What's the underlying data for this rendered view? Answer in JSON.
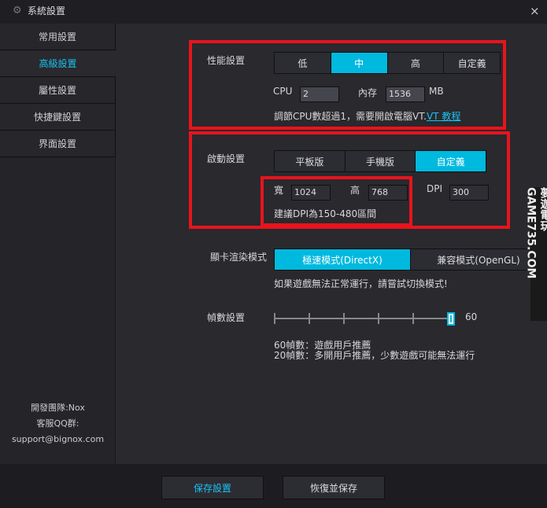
{
  "window": {
    "title": "系統設置",
    "close": "×"
  },
  "sidebar": {
    "items": [
      {
        "label": "常用設置"
      },
      {
        "label": "高級設置"
      },
      {
        "label": "屬性設置"
      },
      {
        "label": "快捷鍵設置"
      },
      {
        "label": "界面設置"
      }
    ],
    "footer": {
      "dev": "開發團隊:Nox",
      "qq": "客服QQ群:",
      "email": "support@bignox.com"
    }
  },
  "performance": {
    "label": "性能設置",
    "options": [
      "低",
      "中",
      "高",
      "自定義"
    ],
    "selected": "中",
    "cpu_label": "CPU",
    "cpu_value": "2",
    "mem_label": "內存",
    "mem_value": "1536",
    "mem_unit": "MB",
    "hint": "調節CPU數超過1，需要開啟電腦VT.",
    "link": "VT 教程"
  },
  "startup": {
    "label": "啟動設置",
    "options": [
      "平板版",
      "手機版",
      "自定義"
    ],
    "selected": "自定義",
    "width_label": "寬",
    "width_value": "1024",
    "height_label": "高",
    "height_value": "768",
    "dpi_label": "DPI",
    "dpi_value": "300",
    "hint": "建議DPI為150-480區間"
  },
  "render": {
    "label": "顯卡渲染模式",
    "options": [
      "極速模式(DirectX)",
      "兼容模式(OpenGL)"
    ],
    "selected": "極速模式(DirectX)",
    "hint": "如果遊戲無法正常運行，請嘗試切換模式!"
  },
  "fps": {
    "label": "幀數設置",
    "value": "60",
    "hint1": "60幀數：遊戲用戶推薦",
    "hint2": "20幀數：多開用戶推薦，少數遊戲可能無法運行"
  },
  "buttons": {
    "save": "保存設置",
    "restore": "恢復並保存"
  },
  "watermark": "夢遊電玩 GAME735.COM",
  "colors": {
    "accent": "#00b9df",
    "highlight": "#e8141c"
  }
}
